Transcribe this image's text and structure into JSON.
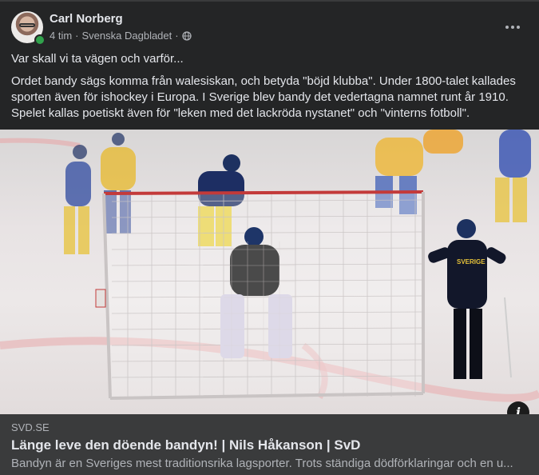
{
  "post": {
    "author": "Carl Norberg",
    "time": "4 tim",
    "source": "Svenska Dagbladet",
    "separator": "·",
    "privacy_icon": "globe-icon",
    "menu_icon": "more-options-icon",
    "headline": "Var skall vi ta vägen och varför...",
    "body": "Ordet bandy sägs komma från walesiskan, och betyda \"böjd klubba\". Under 1800-talet kallades sporten även för ishockey i Europa. I Sverige blev bandy det vedertagna namnet runt år 1910. Spelet kallas poetiskt även för \"leken med det lackröda nystanet\" och \"vinterns fotboll\"."
  },
  "image": {
    "jersey_text": "SVERIGE",
    "info_label": "i"
  },
  "link_preview": {
    "domain": "SVD.SE",
    "title": "Länge leve den döende bandyn! | Nils Håkanson | SvD",
    "description": "Bandyn är en Sveriges mest traditionsrika lagsporter. Trots ständiga dödförklaringar och en u..."
  }
}
